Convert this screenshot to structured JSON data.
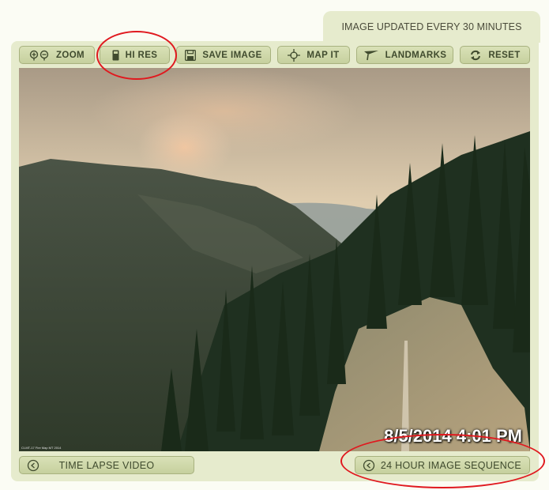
{
  "header": {
    "update_notice": "IMAGE UPDATED EVERY 30 MINUTES"
  },
  "toolbar": {
    "zoom": "ZOOM",
    "hi_res": "HI RES",
    "save_image": "SAVE IMAGE",
    "map_it": "MAP IT",
    "landmarks": "LANDMARKS",
    "reset": "RESET"
  },
  "webcam": {
    "timestamp": "8/5/2014 4:01 PM",
    "overlay_caption": "CI-MT-17 Fire Map MT 2014"
  },
  "footer": {
    "time_lapse": "TIME LAPSE VIDEO",
    "sequence": "24 HOUR IMAGE SEQUENCE"
  },
  "colors": {
    "panel": "#e6ebcd",
    "button": "#ccd5a6",
    "annotation": "#e0191f"
  }
}
